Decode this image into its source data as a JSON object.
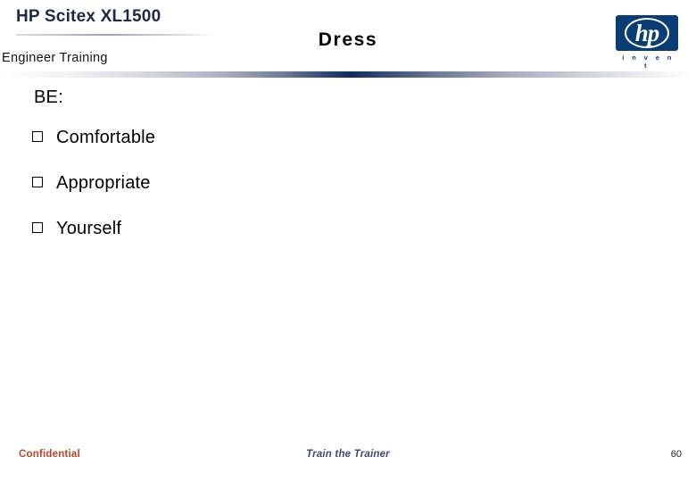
{
  "header": {
    "product_name": "HP Scitex XL1500",
    "course_name": "Engineer Training",
    "slide_title": "Dress",
    "logo": {
      "mark_text": "hp",
      "tagline": "i n v e n t",
      "trademark": "®",
      "box_color": "#0b3d75"
    },
    "divider_accent_color": "#0e2c5c"
  },
  "body": {
    "heading": "BE:",
    "bullet_glyph": "square-outline",
    "bullets": [
      {
        "label": "Comfortable"
      },
      {
        "label": "Appropriate"
      },
      {
        "label": "Yourself"
      }
    ]
  },
  "footer": {
    "confidential": "Confidential",
    "confidential_color": "#b8442a",
    "center_text": "Train the Trainer",
    "center_color": "#3c4a6b",
    "page_number": "60"
  }
}
